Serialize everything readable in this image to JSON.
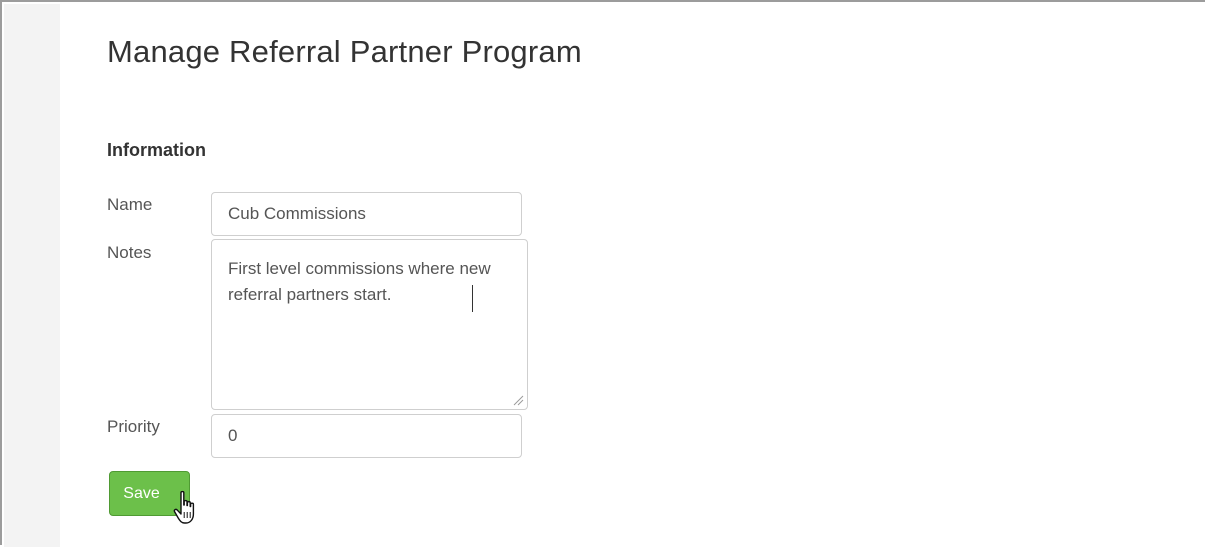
{
  "page": {
    "title": "Manage Referral Partner Program"
  },
  "information": {
    "heading": "Information",
    "name": {
      "label": "Name",
      "value": "Cub Commissions"
    },
    "notes": {
      "label": "Notes",
      "value": "First level commissions where new referral partners start."
    },
    "priority": {
      "label": "Priority",
      "value": "0"
    }
  },
  "actions": {
    "save_label": "Save"
  },
  "colors": {
    "save_button": "#6cc04a",
    "title_text": "#333333",
    "input_border": "#cfcfcf"
  },
  "icons": {
    "pointer": "hand-pointer-icon",
    "resize": "resize-grip-icon"
  }
}
